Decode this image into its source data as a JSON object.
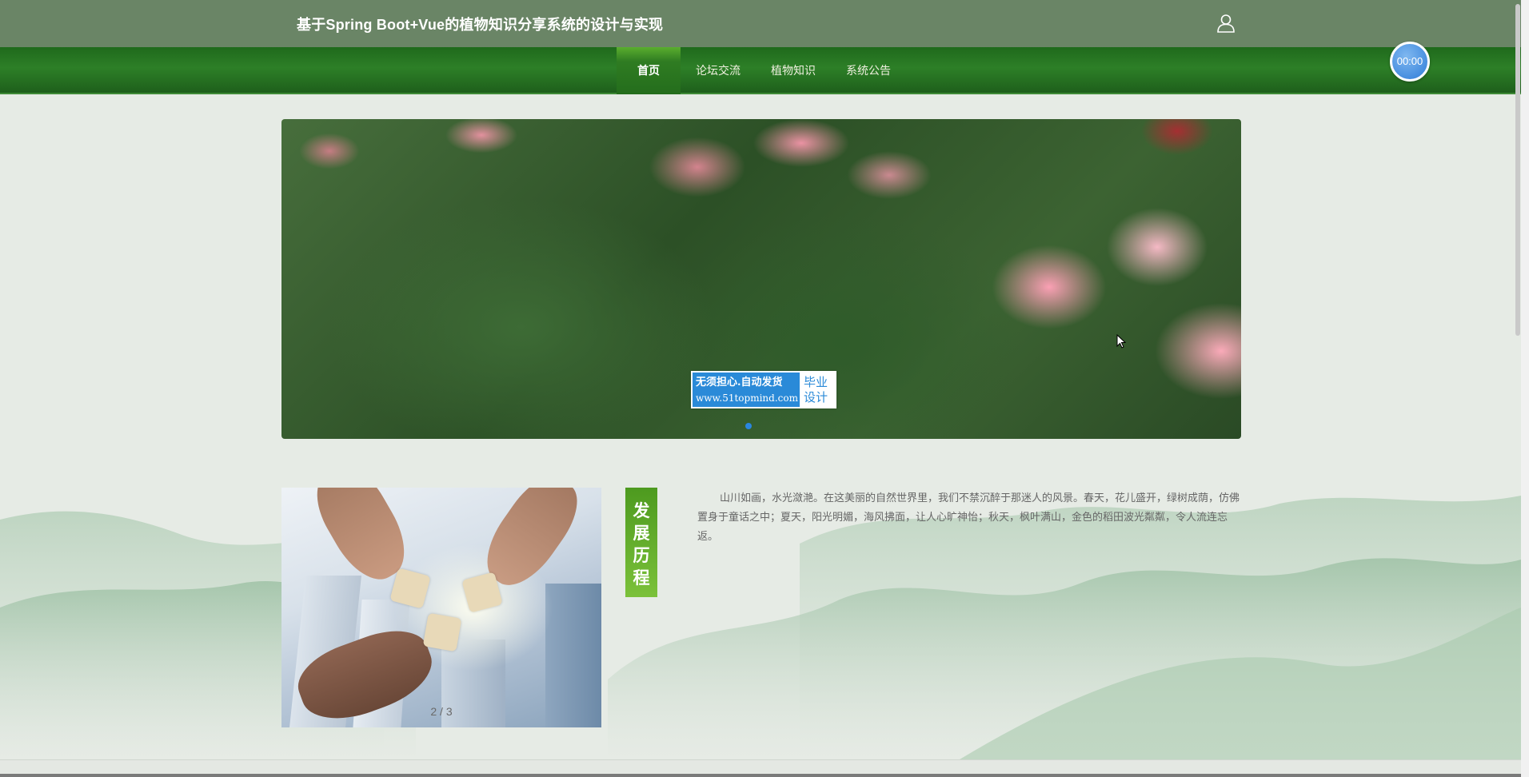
{
  "header": {
    "site_title": "基于Spring Boot+Vue的植物知识分享系统的设计与实现",
    "user_icon": "user-icon"
  },
  "nav": {
    "items": [
      {
        "label": "首页",
        "active": true
      },
      {
        "label": "论坛交流",
        "active": false
      },
      {
        "label": "植物知识",
        "active": false
      },
      {
        "label": "系统公告",
        "active": false
      }
    ]
  },
  "timer": {
    "value": "00:00"
  },
  "banner": {
    "watermark": {
      "line1": "无须担心.自动发货",
      "line2": "www.51topmind.com",
      "tag_line1": "毕业",
      "tag_line2": "设计"
    },
    "active_slide_dot": 1
  },
  "about": {
    "slide_counter": "2 / 3",
    "section_label": [
      "发",
      "展",
      "历",
      "程"
    ],
    "text": "山川如画，水光潋滟。在这美丽的自然世界里，我们不禁沉醉于那迷人的风景。春天，花儿盛开，绿树成荫，仿佛置身于童话之中；夏天，阳光明媚，海风拂面，让人心旷神怡；秋天，枫叶满山，金色的稻田波光粼粼，令人流连忘返。"
  },
  "colors": {
    "topbar": "#6a8566",
    "navbar": "#236b1f",
    "accent_green": "#5aa52a",
    "timer_blue": "#2f7cd8",
    "page_bg": "#e6ebe5"
  }
}
